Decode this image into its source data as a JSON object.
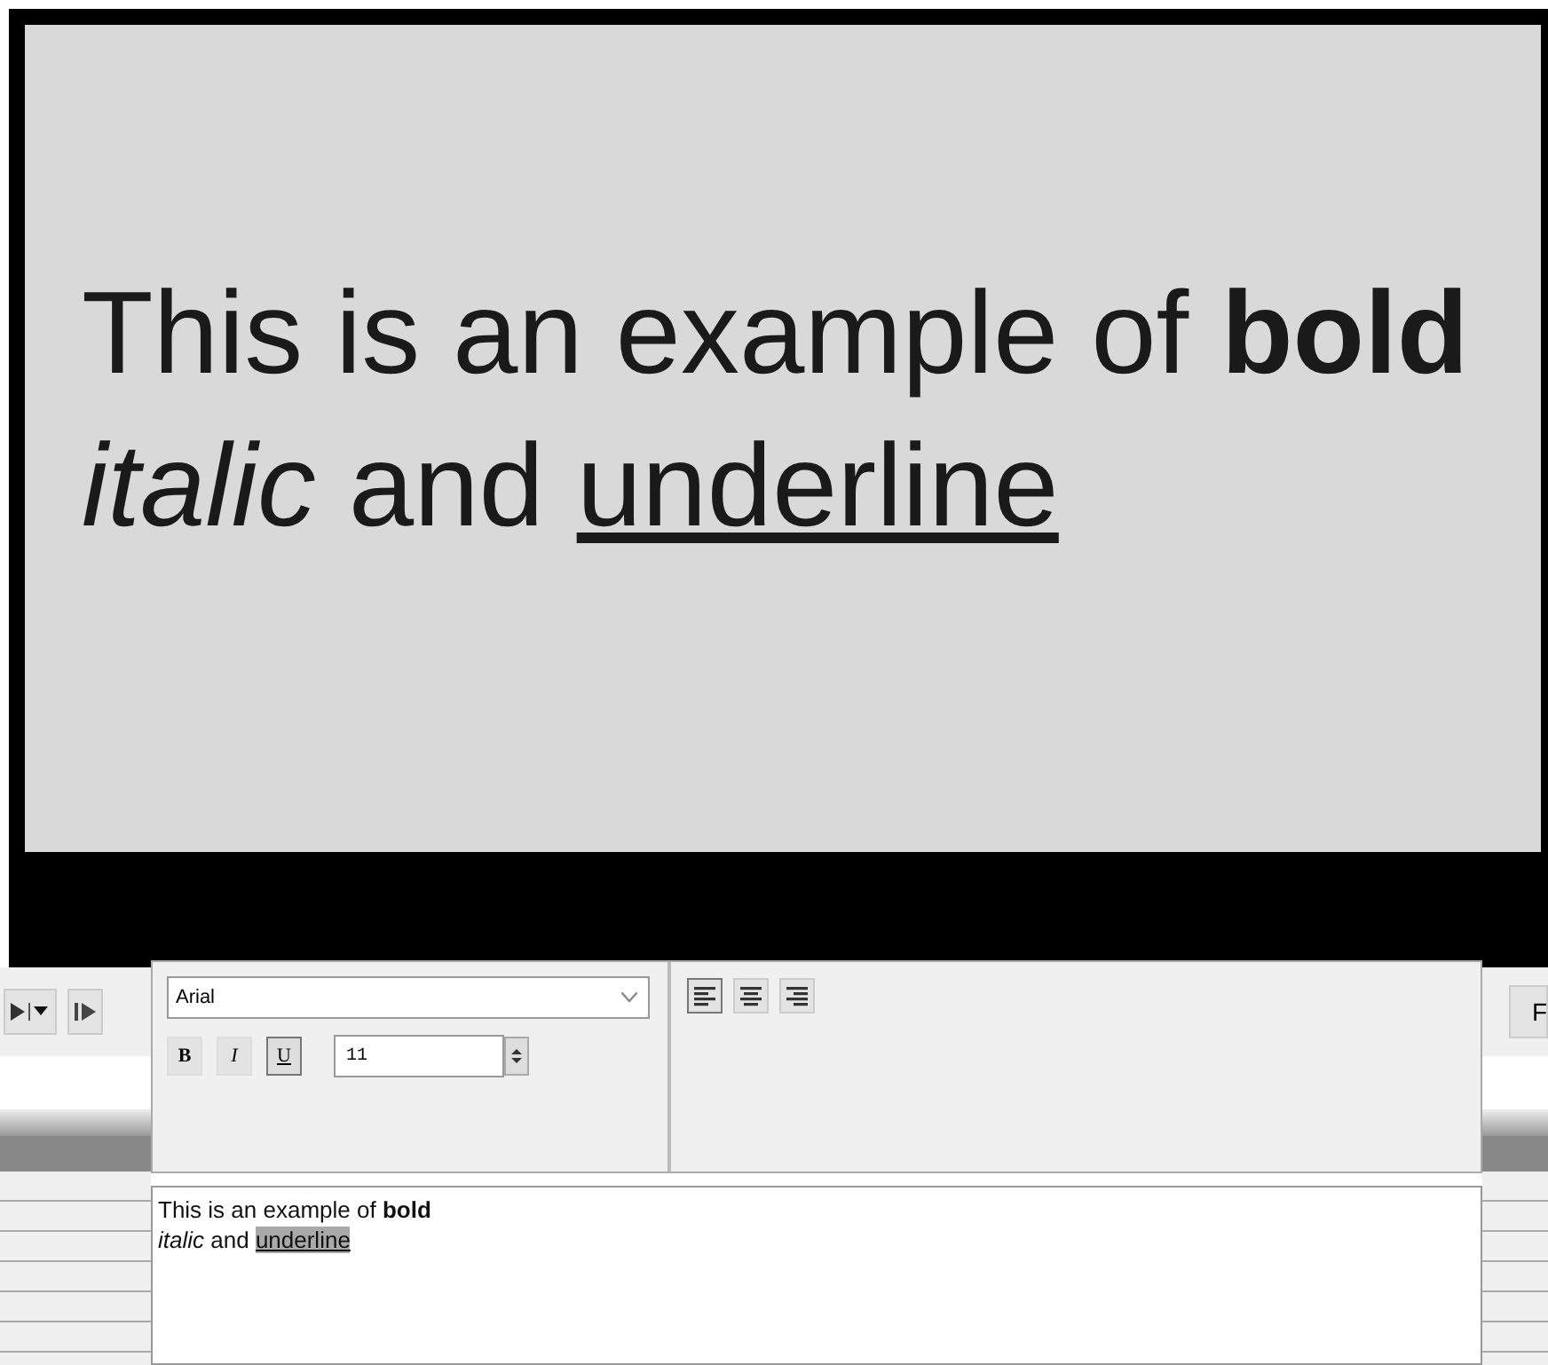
{
  "slide": {
    "lines": [
      {
        "runs": [
          {
            "text": "This is an example of ",
            "kind": "plain"
          },
          {
            "text": "bold",
            "kind": "bold"
          }
        ]
      },
      {
        "runs": [
          {
            "text": "italic",
            "kind": "italic"
          },
          {
            "text": " and ",
            "kind": "plain"
          },
          {
            "text": "underline",
            "kind": "underline"
          }
        ]
      }
    ]
  },
  "format_panel": {
    "font": {
      "value": "Arial"
    },
    "style_buttons": [
      {
        "label": "B",
        "kind": "bold",
        "selected": false
      },
      {
        "label": "I",
        "kind": "italic",
        "selected": false
      },
      {
        "label": "U",
        "kind": "underline",
        "selected": true
      }
    ],
    "size": {
      "value": "11"
    },
    "align_buttons": [
      {
        "kind": "left",
        "selected": true
      },
      {
        "kind": "center",
        "selected": false
      },
      {
        "kind": "right",
        "selected": false
      }
    ]
  },
  "editor": {
    "lines": [
      {
        "runs": [
          {
            "text": "This is an example of ",
            "kind": "plain",
            "selected": false
          },
          {
            "text": "bold",
            "kind": "bold",
            "selected": false
          }
        ]
      },
      {
        "runs": [
          {
            "text": "italic",
            "kind": "italic",
            "selected": false
          },
          {
            "text": " and ",
            "kind": "plain",
            "selected": false
          },
          {
            "text": "underline",
            "kind": "underline",
            "selected": true
          }
        ]
      }
    ]
  },
  "right_toolbar": {
    "button": "F"
  }
}
